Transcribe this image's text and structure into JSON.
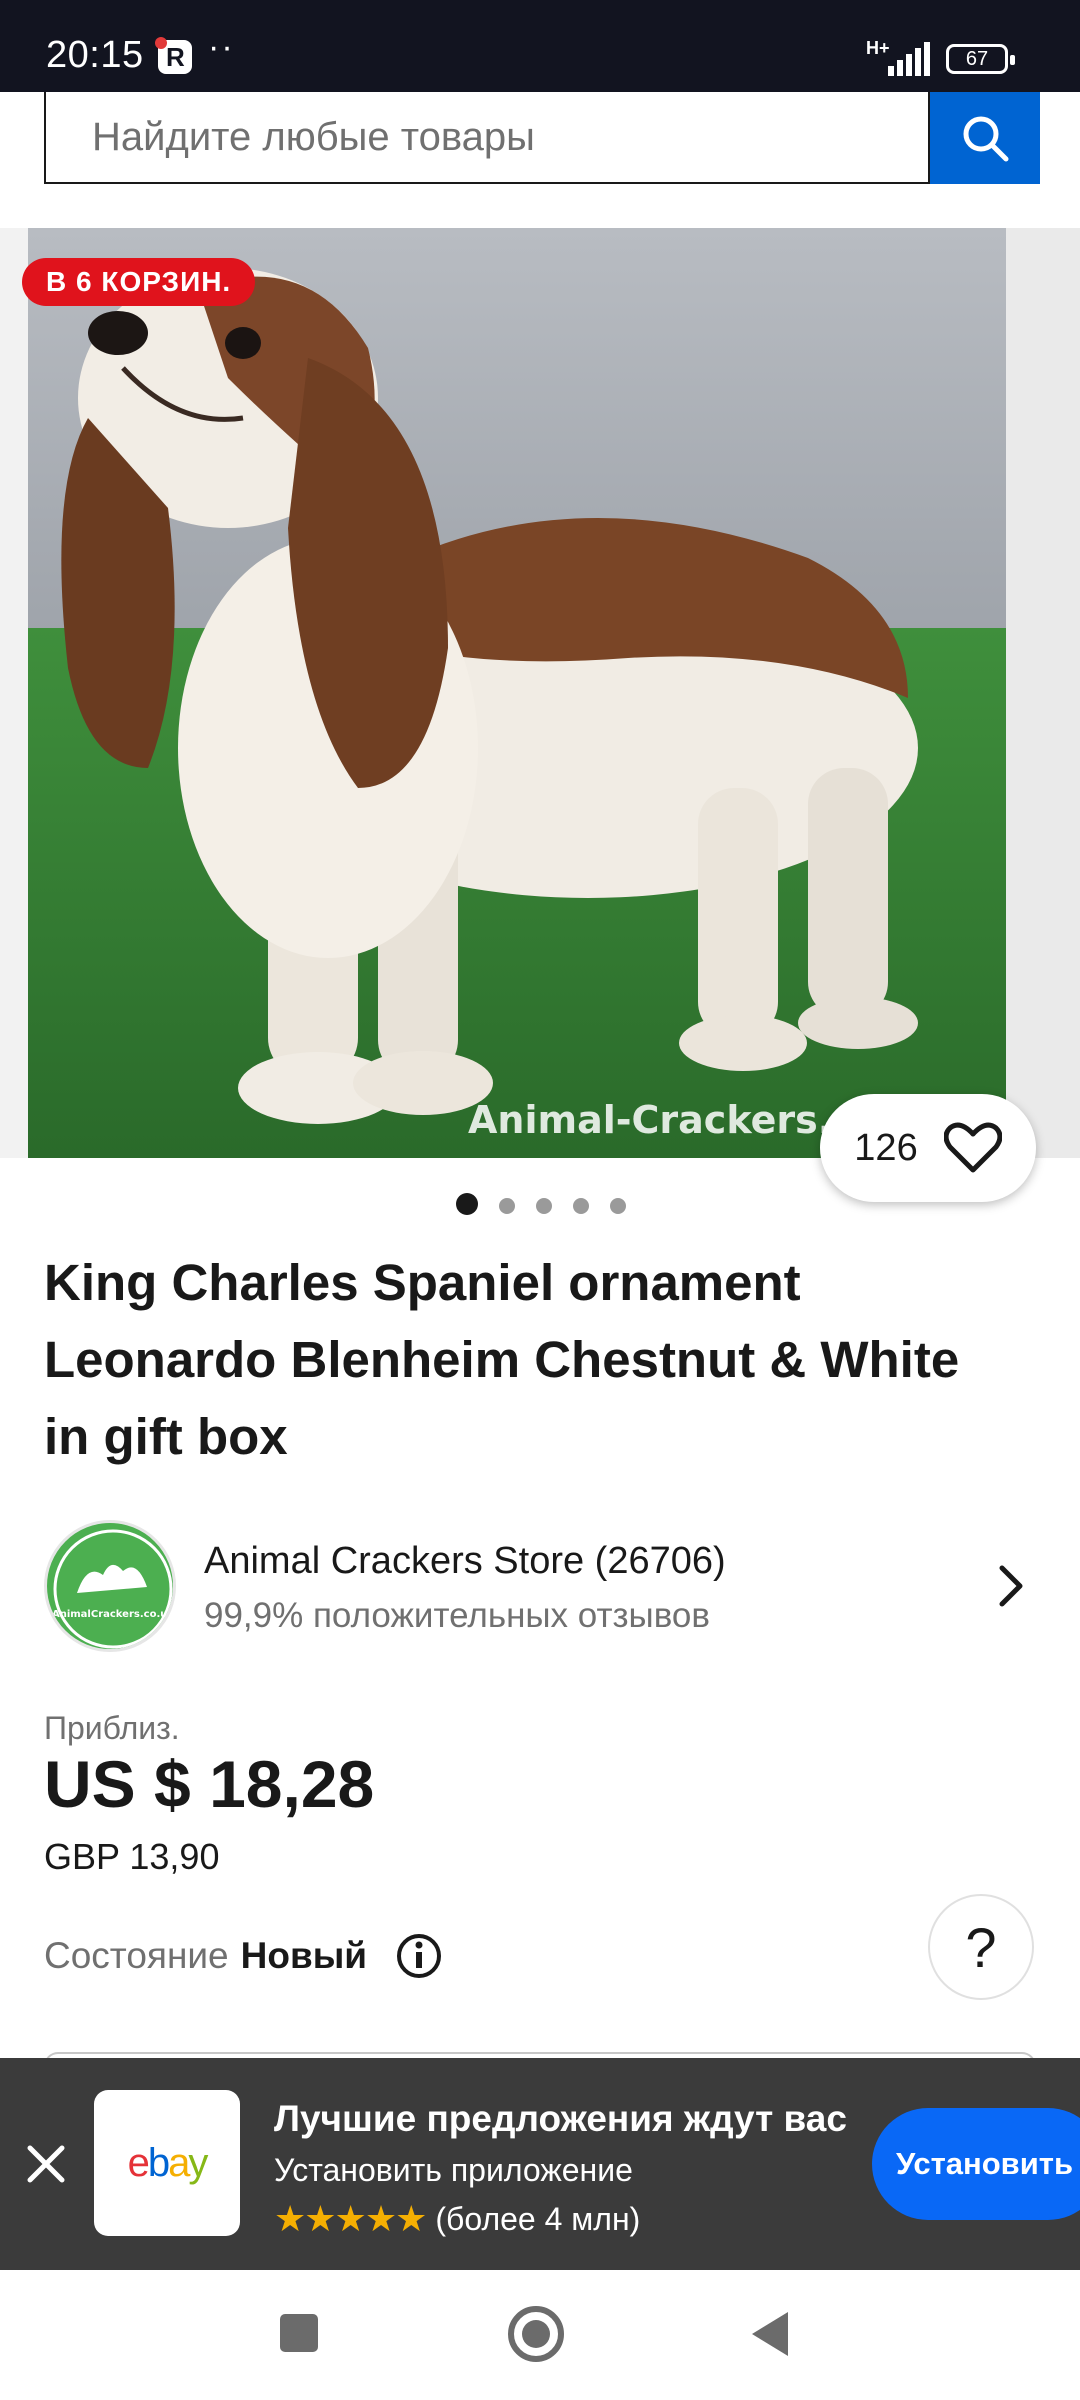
{
  "status": {
    "time": "20:15",
    "app_badge": "R",
    "dots": "··",
    "network": "H+",
    "battery": "67"
  },
  "search": {
    "placeholder": "Найдите любые товары"
  },
  "gallery": {
    "basket_badge": "В 6 КОРЗИН.",
    "watermark": "Animal-Crackers.c",
    "watch_count": "126",
    "dots_total": 5,
    "dots_active": 0
  },
  "item": {
    "title": "King Charles Spaniel ornament Leonardo Blenheim Chestnut & White in gift box"
  },
  "seller": {
    "name": "Animal Crackers Store (26706)",
    "feedback": "99,9% положительных отзывов",
    "logo_text": "AnimalCrackers.co.uk"
  },
  "price": {
    "approx_label": "Приблиз.",
    "usd": "US $ 18,28",
    "gbp": "GBP 13,90"
  },
  "condition": {
    "label": "Состояние",
    "value": "Новый"
  },
  "help": {
    "symbol": "?"
  },
  "banner": {
    "title": "Лучшие предложения ждут вас",
    "subtitle": "Установить приложение",
    "stars": "★★★★★",
    "rating_text": "(более 4 млн)",
    "install_label": "Установить"
  },
  "colors": {
    "brand_blue": "#0064d2",
    "badge_red": "#e0131c",
    "banner_bg": "#3b3b3b",
    "install_blue": "#0968f6"
  }
}
